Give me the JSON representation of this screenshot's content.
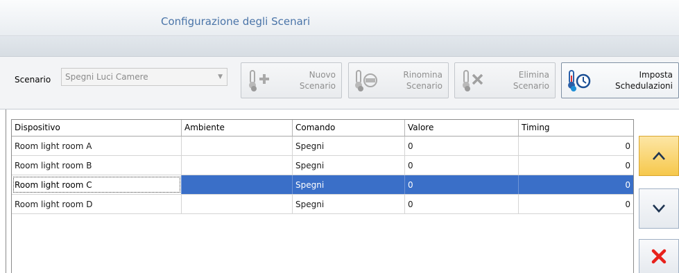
{
  "window": {
    "title": "Configurazione degli Scenari"
  },
  "toolbar": {
    "scenario_label": "Scenario",
    "scenario_value": "Spegni Luci Camere",
    "buttons": [
      {
        "label_line1": "Nuovo",
        "label_line2": "Scenario",
        "icon": "thermometer-plus-icon",
        "enabled": false
      },
      {
        "label_line1": "Rinomina",
        "label_line2": "Scenario",
        "icon": "thermometer-rename-icon",
        "enabled": false
      },
      {
        "label_line1": "Elimina",
        "label_line2": "Scenario",
        "icon": "thermometer-delete-icon",
        "enabled": false
      },
      {
        "label_line1": "Imposta",
        "label_line2": "Schedulazioni",
        "icon": "thermometer-clock-icon",
        "enabled": true
      }
    ]
  },
  "grid": {
    "columns": [
      "Dispositivo",
      "Ambiente",
      "Comando",
      "Valore",
      "Timing"
    ],
    "rows": [
      {
        "dispositivo": "Room light room A",
        "ambiente": "",
        "comando": "Spegni",
        "valore": "0",
        "timing": "0",
        "selected": false
      },
      {
        "dispositivo": "Room light room B",
        "ambiente": "",
        "comando": "Spegni",
        "valore": "0",
        "timing": "0",
        "selected": false
      },
      {
        "dispositivo": "Room light room C",
        "ambiente": "",
        "comando": "Spegni",
        "valore": "0",
        "timing": "0",
        "selected": true
      },
      {
        "dispositivo": "Room light room D",
        "ambiente": "",
        "comando": "Spegni",
        "valore": "0",
        "timing": "0",
        "selected": false
      }
    ]
  },
  "side_buttons": [
    {
      "icon": "chevron-up-icon"
    },
    {
      "icon": "chevron-down-icon"
    },
    {
      "icon": "close-icon",
      "color": "#e8211b"
    }
  ],
  "colors": {
    "selection": "#3a6fc8",
    "title": "#4a74a8",
    "move_up_active": "#f6c84c"
  }
}
